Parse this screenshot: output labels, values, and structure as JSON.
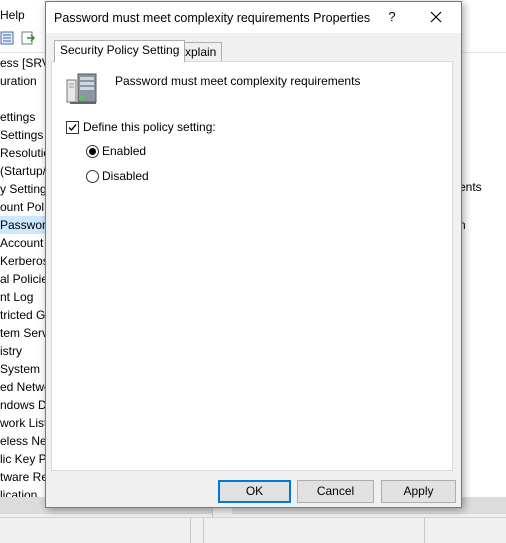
{
  "background_window": {
    "menu_help": "Help",
    "tree_items": [
      "ess [SRV",
      "uration",
      "",
      "ettings",
      "Settings",
      "Resolutio",
      "(Startup/",
      "y Setting",
      "ount Pol",
      "Passwor",
      "Account",
      "Kerberos",
      "al Policie",
      "nt Log",
      "tricted G",
      "tem Serv",
      "istry",
      "System",
      "ed Netwo",
      "ndows De",
      "work List",
      "eless Net",
      "lic Key P",
      "tware Res",
      "lication"
    ],
    "selected_tree_index": 9,
    "right_text_1": "ents",
    "right_text_2": "n"
  },
  "dialog": {
    "title": "Password must meet complexity requirements Properties",
    "help_glyph": "?",
    "tabs": [
      {
        "label": "Security Policy Setting",
        "active": true
      },
      {
        "label": "Explain",
        "active": false
      }
    ],
    "policy_title": "Password must meet complexity requirements",
    "define_checkbox": {
      "label": "Define this policy setting:",
      "checked": true
    },
    "radios": [
      {
        "label": "Enabled",
        "selected": true
      },
      {
        "label": "Disabled",
        "selected": false
      }
    ],
    "buttons": {
      "ok": "OK",
      "cancel": "Cancel",
      "apply": "Apply"
    }
  }
}
